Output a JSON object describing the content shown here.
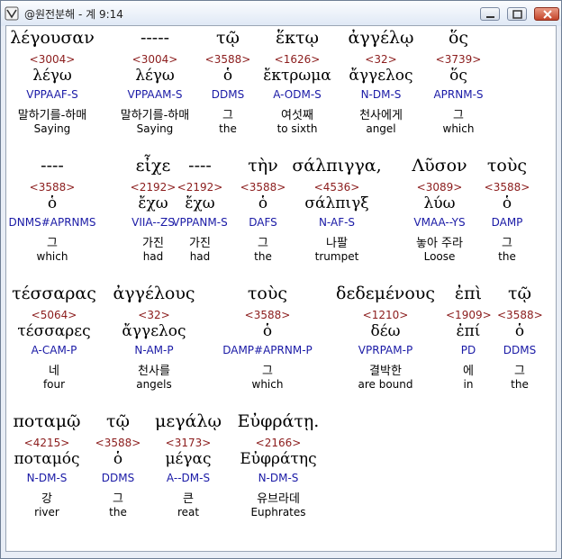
{
  "window": {
    "title": "@원전분해 - 계 9:14",
    "minimize_label": "minimize",
    "maximize_label": "maximize",
    "close_label": "close"
  },
  "rows": [
    {
      "words": [
        {
          "greek": "λέγουσαν",
          "strong": "<3004>",
          "lexeme": "λέγω",
          "morph": "VPPAAF-S",
          "korean": "말하기를-하매",
          "english": "Saying",
          "selected": true
        },
        {
          "greek": "-----",
          "strong": "<3004>",
          "lexeme": "λέγω",
          "morph": "VPPAAM-S",
          "korean": "말하기를-하매",
          "english": "Saying"
        },
        {
          "greek": "τῷ",
          "strong": "<3588>",
          "lexeme": "ὁ",
          "morph": "DDMS",
          "korean": "그",
          "english": "the"
        },
        {
          "greek": "ἕκτῳ",
          "strong": "<1626>",
          "lexeme": "ἔκτρωμα",
          "morph": "A-ODM-S",
          "korean": "여섯째",
          "english": "to sixth"
        },
        {
          "greek": "ἀγγέλῳ",
          "strong": "<32>",
          "lexeme": "ἄγγελος",
          "morph": "N-DM-S",
          "korean": "천사에게",
          "english": "angel"
        },
        {
          "greek": "ὅς",
          "strong": "<3739>",
          "lexeme": "ὅς",
          "morph": "APRNM-S",
          "korean": "그",
          "english": "which"
        }
      ]
    },
    {
      "words": [
        {
          "greek": "----",
          "strong": "<3588>",
          "lexeme": "ὁ",
          "morph": "DNMS#APRNMS",
          "korean": "그",
          "english": "which"
        },
        {
          "greek": "εἶχε",
          "strong": "<2192>",
          "lexeme": "ἔχω",
          "morph": "VIIA--ZS",
          "korean": "가진",
          "english": "had"
        },
        {
          "greek": "----",
          "strong": "<2192>",
          "lexeme": "ἔχω",
          "morph": "VPPANM-S",
          "korean": "가진",
          "english": "had"
        },
        {
          "greek": "τὴν",
          "strong": "<3588>",
          "lexeme": "ὁ",
          "morph": "DAFS",
          "korean": "그",
          "english": "the"
        },
        {
          "greek": "σάλπιγγα,",
          "strong": "<4536>",
          "lexeme": "σάλπιγξ",
          "morph": "N-AF-S",
          "korean": "나팔",
          "english": "trumpet"
        },
        {
          "greek": "Λῦσον",
          "strong": "<3089>",
          "lexeme": "λύω",
          "morph": "VMAA--YS",
          "korean": "놓아 주라",
          "english": "Loose"
        },
        {
          "greek": "τοὺς",
          "strong": "<3588>",
          "lexeme": "ὁ",
          "morph": "DAMP",
          "korean": "그",
          "english": "the"
        }
      ]
    },
    {
      "words": [
        {
          "greek": "τέσσαρας",
          "strong": "<5064>",
          "lexeme": "τέσσαρες",
          "morph": "A-CAM-P",
          "korean": "네",
          "english": "four"
        },
        {
          "greek": "ἀγγέλους",
          "strong": "<32>",
          "lexeme": "ἄγγελος",
          "morph": "N-AM-P",
          "korean": "천사를",
          "english": "angels"
        },
        {
          "greek": "τοὺς",
          "strong": "<3588>",
          "lexeme": "ὁ",
          "morph": "DAMP#APRNM-P",
          "korean": "그",
          "english": "which"
        },
        {
          "greek": "δεδεμένους",
          "strong": "<1210>",
          "lexeme": "δέω",
          "morph": "VPRPAM-P",
          "korean": "결박한",
          "english": "are bound"
        },
        {
          "greek": "ἐπὶ",
          "strong": "<1909>",
          "lexeme": "ἐπί",
          "morph": "PD",
          "korean": "에",
          "english": "in"
        },
        {
          "greek": "τῷ",
          "strong": "<3588>",
          "lexeme": "ὁ",
          "morph": "DDMS",
          "korean": "그",
          "english": "the"
        }
      ]
    },
    {
      "words": [
        {
          "greek": "ποταμῷ",
          "strong": "<4215>",
          "lexeme": "ποταμός",
          "morph": "N-DM-S",
          "korean": "강",
          "english": "river"
        },
        {
          "greek": "τῷ",
          "strong": "<3588>",
          "lexeme": "ὁ",
          "morph": "DDMS",
          "korean": "그",
          "english": "the"
        },
        {
          "greek": "μεγάλῳ",
          "strong": "<3173>",
          "lexeme": "μέγας",
          "morph": "A--DM-S",
          "korean": "큰",
          "english": "reat"
        },
        {
          "greek": "Εὐφράτῃ.",
          "strong": "<2166>",
          "lexeme": "Εὐφράτης",
          "morph": "N-DM-S",
          "korean": "유브라데",
          "english": "Euphrates"
        }
      ]
    }
  ]
}
